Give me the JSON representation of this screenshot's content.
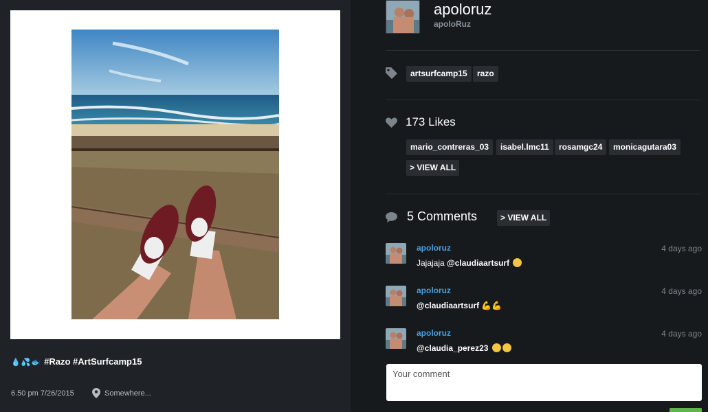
{
  "post": {
    "caption_emoji": "💧💦🐟",
    "caption_text": "#Razo #ArtSurfcamp15",
    "time": "6.50 pm 7/26/2015",
    "location": "Somewhere..."
  },
  "author": {
    "username": "apoloruz",
    "handle": "apoloRuz"
  },
  "tags": [
    "artsurfcamp15",
    "razo"
  ],
  "likes": {
    "count_label": "173 Likes",
    "users": [
      "mario_contreras_03",
      "isabel.lmc11",
      "rosamgc24",
      "monicagutara03"
    ],
    "view_all": "> VIEW ALL"
  },
  "comments": {
    "count_label": "5 Comments",
    "view_all": "> VIEW ALL",
    "items": [
      {
        "user": "apoloruz",
        "time": "4 days ago",
        "text": "Jajajaja",
        "mention": "@claudiaartsurf",
        "emoji": "😉"
      },
      {
        "user": "apoloruz",
        "time": "4 days ago",
        "text": "",
        "mention": "@claudiaartsurf",
        "emoji": "💪💪"
      },
      {
        "user": "apoloruz",
        "time": "4 days ago",
        "text": "",
        "mention": "@claudia_perez23",
        "emoji": "😊😊"
      }
    ],
    "input_placeholder": "Your comment"
  },
  "colors": {
    "left_bg": "#1f2226",
    "right_bg": "#161a1d",
    "chip_bg": "#2a2e33",
    "link_blue": "#4a9fe0",
    "send_green": "#5fb44b"
  }
}
